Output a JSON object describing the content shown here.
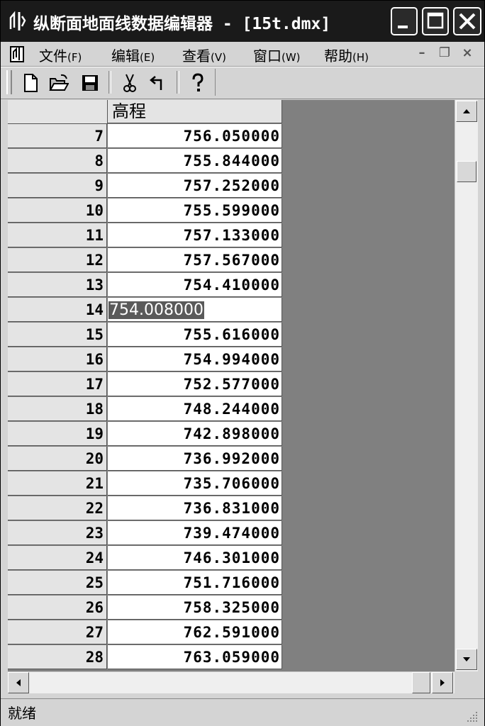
{
  "window": {
    "title": "纵断面地面线数据编辑器 - [15t.dmx]"
  },
  "menu": [
    {
      "label": "文件",
      "accel": "(F)"
    },
    {
      "label": "编辑",
      "accel": "(E)"
    },
    {
      "label": "查看",
      "accel": "(V)"
    },
    {
      "label": "窗口",
      "accel": "(W)"
    },
    {
      "label": "帮助",
      "accel": "(H)"
    }
  ],
  "mdi_controls": {
    "minimize": "–",
    "restore": "❐",
    "close": "×"
  },
  "toolbar": {
    "icons": [
      "new-file-icon",
      "open-folder-icon",
      "save-disk-icon",
      "cut-scissors-icon",
      "undo-arrow-icon",
      "help-question-icon"
    ]
  },
  "grid": {
    "column_header": "高程",
    "editing_row_index": 7,
    "rows": [
      {
        "num": "7",
        "value": "756.050000"
      },
      {
        "num": "8",
        "value": "755.844000"
      },
      {
        "num": "9",
        "value": "757.252000"
      },
      {
        "num": "10",
        "value": "755.599000"
      },
      {
        "num": "11",
        "value": "757.133000"
      },
      {
        "num": "12",
        "value": "757.567000"
      },
      {
        "num": "13",
        "value": "754.410000"
      },
      {
        "num": "14",
        "value": "754.008000"
      },
      {
        "num": "15",
        "value": "755.616000"
      },
      {
        "num": "16",
        "value": "754.994000"
      },
      {
        "num": "17",
        "value": "752.577000"
      },
      {
        "num": "18",
        "value": "748.244000"
      },
      {
        "num": "19",
        "value": "742.898000"
      },
      {
        "num": "20",
        "value": "736.992000"
      },
      {
        "num": "21",
        "value": "735.706000"
      },
      {
        "num": "22",
        "value": "736.831000"
      },
      {
        "num": "23",
        "value": "739.474000"
      },
      {
        "num": "24",
        "value": "746.301000"
      },
      {
        "num": "25",
        "value": "751.716000"
      },
      {
        "num": "26",
        "value": "758.325000"
      },
      {
        "num": "27",
        "value": "762.591000"
      },
      {
        "num": "28",
        "value": "763.059000"
      }
    ]
  },
  "status": {
    "text": "就绪"
  }
}
